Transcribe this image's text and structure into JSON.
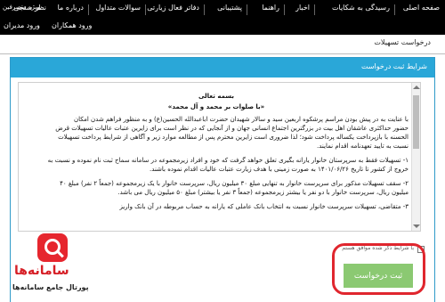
{
  "topnav": {
    "items": [
      "صفحه اصلی",
      "رسیدگی به شکایات",
      "اخبار",
      "راهنما",
      "پشتیبانی",
      "دفاتر فعال زیارتی",
      "سوالات متداول",
      "درباره ما",
      "نظر سنجی",
      "ویژه متصرفین"
    ]
  },
  "subnav": {
    "items": [
      "ورود همکاران",
      "ورود مدیران"
    ]
  },
  "breadcrumb": "درخواست تسهیلات",
  "panel": {
    "title": "شرایط ثبت درخواست"
  },
  "document": {
    "heading": "بسمه تعالی",
    "salutation": "«با صلوات بر محمد و آل محمد»",
    "lines": [
      "با عنایت به در پیش بودن مراسم پرشکوه اربعین سید و سالار شهیدان حضرت اباعبدالله الحسین(ع) و به منظور فراهم شدن امکان",
      "حضور حداکثری عاشقان اهل بیت در بزرگترین اجتماع انسانی جهان و از آنجایی که در نظر است برای زایرین عتبات عالیات تسهیلات قرض",
      "الحسنه با بازپرداخت یکساله پرداخت شود؛ لذا ضروری است زایرین محترم پس از مطالعه موارد زیر و آگاهی از شرایط پرداخت تسهیلات",
      "نسبت به تایید تعهدنامه اقدام نمایند.",
      "۱- تسهیلات فقط به سرپرستان خانوار یارانه بگیری تعلق خواهد گرفت که خود و افراد زیرمجموعه در سامانه سماح ثبت نام نموده و نسبت به",
      "خروج از کشور تا تاریخ ۱۴۰۱/۰۶/۲۶ به صورت زمینی با هدف زیارت عتبات عالیات اقدام نموده باشند.",
      "۲- سقف تسهیلات مذکور برای سرپرست خانوار به تنهایی مبلغ ۳۰ میلیون ریال، سرپرست خانوار با یک زیرمجموعه (جمعاً ۲ نفر) مبلغ ۴۰",
      "میلیون ریال، سرپرست خانوار با دو نفر یا بیشتر زیرمجموعه (جمعاً ۳ نفر یا بیشتر) مبلغ ۵۰ میلیون ریال می باشد.",
      "۳- متقاضی، تسهیلات سرپرست خانوار نسبت به انتخاب بانک عاملی که یارانه به  حساب مربوطه در آن بانک واریز"
    ]
  },
  "agreement": {
    "label": "با شرایط ذکر شده موافق هستم"
  },
  "submit": {
    "label": "ثبت درخواست"
  },
  "watermark": {
    "name": "سامانه‌ها",
    "tagline": "پورتال جامع سامانه‌ها"
  },
  "colors": {
    "nav_bg": "#000000",
    "panel_header": "#2aa7d8",
    "submit_bg": "#8bc972",
    "highlight_border": "#e0262e"
  }
}
